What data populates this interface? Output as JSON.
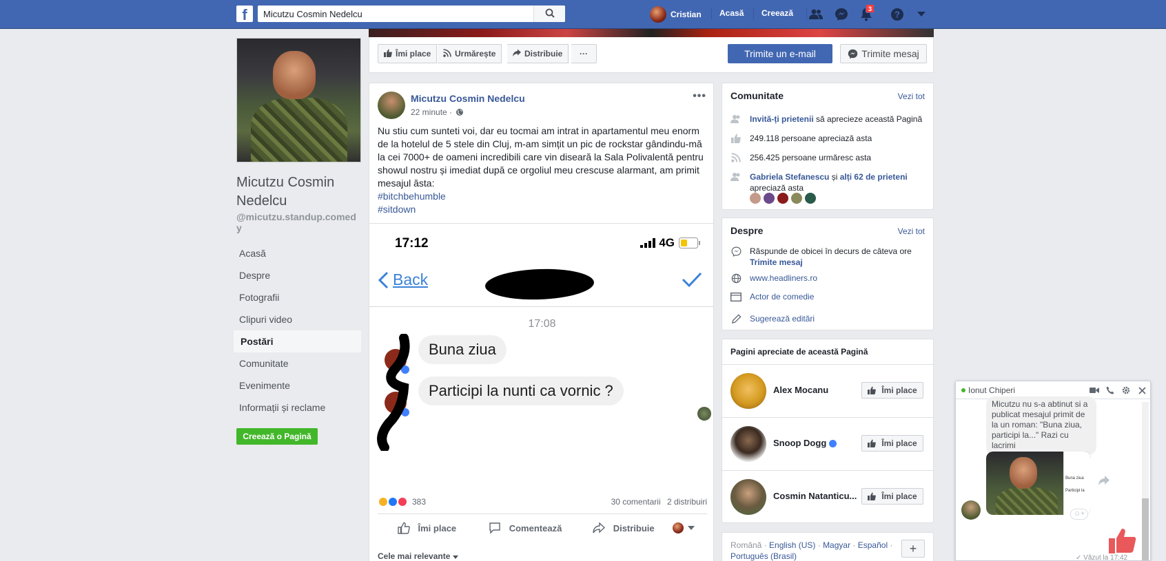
{
  "topbar": {
    "logo": "f",
    "search_value": "Micutzu Cosmin Nedelcu",
    "user_name": "Cristian",
    "home": "Acasă",
    "create": "Creează",
    "notif_count": "3",
    "icons": [
      "friends-icon",
      "messenger-icon",
      "notifications-icon",
      "help-icon",
      "dropdown-icon"
    ],
    "brand_color": "#4267b2"
  },
  "profile": {
    "name": "Micutzu Cosmin Nedelcu",
    "handle": "@micutzu.standup.comedy"
  },
  "side_nav": [
    {
      "label": "Acasă"
    },
    {
      "label": "Despre"
    },
    {
      "label": "Fotografii"
    },
    {
      "label": "Clipuri video"
    },
    {
      "label": "Postări"
    },
    {
      "label": "Comunitate"
    },
    {
      "label": "Evenimente"
    },
    {
      "label": "Informații și reclame"
    }
  ],
  "create_page": "Creează o Pagină",
  "action_bar": {
    "like": "Îmi place",
    "follow": "Urmărește",
    "share": "Distribuie",
    "more": "···",
    "email": "Trimite un e-mail",
    "message": "Trimite mesaj"
  },
  "post": {
    "author": "Micutzu Cosmin Nedelcu",
    "time": "22 minute ·",
    "text": "Nu stiu cum sunteti voi, dar eu tocmai am intrat in apartamentul meu enorm de la hotelul de 5 stele din Cluj, m-am simțit un pic de rockstar gândindu-mă la cei 7000+ de oameni incredibili care vin diseară la Sala Polivalentă pentru showul nostru și imediat după ce orgoliul meu crescuse alarmant, am primit mesajul ăsta:",
    "tags": [
      "#bitchbehumble",
      "#sitdown"
    ],
    "image": {
      "clock": "17:12",
      "network": "4G",
      "back": "Back",
      "msg_time": "17:08",
      "bubble1": "Buna ziua",
      "bubble2": "Participi la nunti ca vornic ?"
    },
    "reaction_count": "383",
    "comments": "30 comentarii",
    "shares": "2 distribuiri",
    "actions": {
      "like": "Îmi place",
      "comment": "Comentează",
      "share": "Distribuie"
    },
    "sort": "Cele mai relevante"
  },
  "community": {
    "title": "Comunitate",
    "see_all": "Vezi tot",
    "invite_link": "Invită-ți prietenii",
    "invite_rest": " să aprecieze această Pagină",
    "likes": "249.118 persoane apreciază asta",
    "follows": "256.425 persoane urmăresc asta",
    "friend1": "Gabriela Stefanescu",
    "and": " și ",
    "friends_more": "alți 62 de prieteni",
    "friends_rest": "apreciază asta"
  },
  "about": {
    "title": "Despre",
    "see_all": "Vezi tot",
    "response": "Răspunde de obicei în decurs de câteva ore",
    "send_msg": "Trimite mesaj",
    "website": "www.headliners.ro",
    "category": "Actor de comedie",
    "suggest": "Sugerează editări"
  },
  "liked_pages": {
    "title": "Pagini apreciate de această Pagină",
    "items": [
      {
        "name": "Alex Mocanu",
        "button": "Îmi place"
      },
      {
        "name": "Snoop Dogg",
        "button": "Îmi place"
      },
      {
        "name": "Cosmin Natanticu...",
        "button": "Îmi place"
      }
    ]
  },
  "languages": {
    "current": "Română",
    "sep": " · ",
    "list": [
      "English (US)",
      "Magyar",
      "Español",
      "Português (Brasil)"
    ],
    "plus": "+"
  },
  "chat": {
    "name": "Ionut Chiperi",
    "message": "Micutzu nu s-a abtinut si a publicat mesajul primit de la un roman: \"Buna ziua, participi la...\" Razi cu lacrimi",
    "img_text1": "Buna ziua",
    "img_text2": "Participi la",
    "seen": "✓ Văzut la 17:42"
  }
}
